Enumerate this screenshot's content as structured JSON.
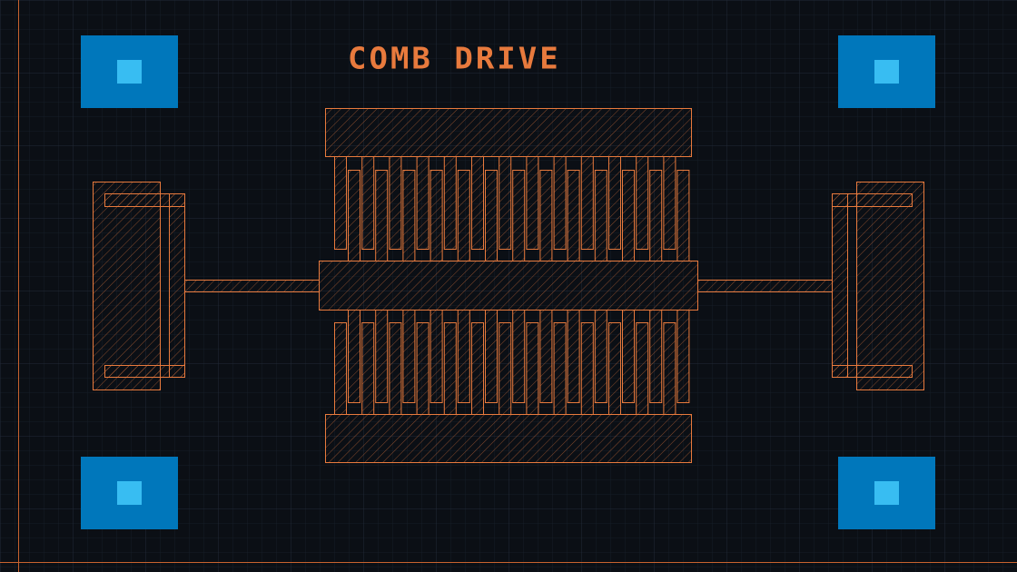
{
  "title": "COMB DRIVE",
  "colors": {
    "background": "#0b0f15",
    "grid_minor": "#18202b",
    "grid_major": "#222c3a",
    "layer_structure": "#e87a3d",
    "pad_outer": "#0077bb",
    "pad_inner": "#38bdf2"
  },
  "layers": {
    "structure": {
      "name": "structure-layer",
      "fill": "hatched"
    },
    "contact_pads": {
      "name": "pad-layer",
      "fill": "solid"
    }
  },
  "comb": {
    "upper_finger_count": 13,
    "lower_finger_count": 13
  }
}
